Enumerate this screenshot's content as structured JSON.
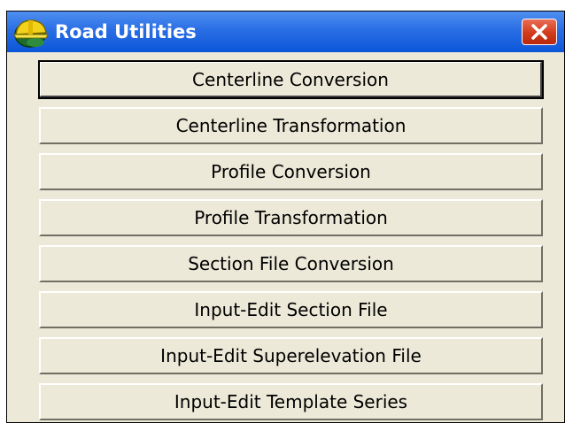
{
  "window": {
    "title": "Road Utilities"
  },
  "icons": {
    "app": "helmet-icon",
    "close": "close-icon"
  },
  "colors": {
    "titlebar": "#2a6ee5",
    "close_button": "#d23b1a",
    "window_background": "#ece9d8"
  },
  "buttons": [
    {
      "label": "Centerline Conversion",
      "default": true
    },
    {
      "label": "Centerline Transformation"
    },
    {
      "label": "Profile Conversion"
    },
    {
      "label": "Profile Transformation"
    },
    {
      "label": "Section File Conversion"
    },
    {
      "label": "Input-Edit Section File"
    },
    {
      "label": "Input-Edit Superelevation File"
    },
    {
      "label": "Input-Edit Template Series"
    }
  ]
}
